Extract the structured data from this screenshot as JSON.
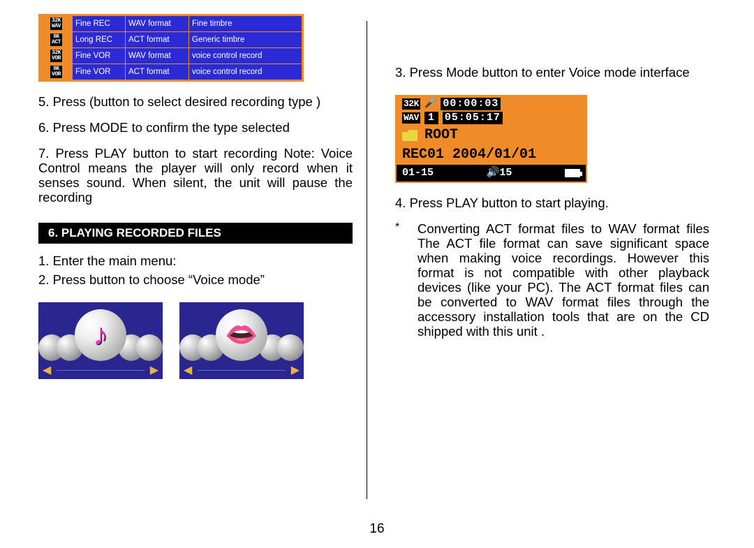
{
  "page_number": "16",
  "rec_table": {
    "rows": [
      {
        "badge_top": "32K",
        "badge_bot": "WAV",
        "mode": "Fine REC",
        "format": "WAV format",
        "desc": "Fine timbre"
      },
      {
        "badge_top": "8K",
        "badge_bot": "ACT",
        "mode": "Long REC",
        "format": "ACT format",
        "desc": "Generic timbre"
      },
      {
        "badge_top": "32K",
        "badge_bot": "VOR",
        "mode": "Fine VOR",
        "format": "WAV format",
        "desc": "voice control record"
      },
      {
        "badge_top": "8K",
        "badge_bot": "VOR",
        "mode": "Fine VOR",
        "format": "ACT format",
        "desc": "voice control record"
      }
    ]
  },
  "left": {
    "step5": "5. Press (button to select desired recording type )",
    "step6": "6. Press MODE to confirm the type selected",
    "step7": "7. Press PLAY button to start recording Note: Voice Control means the player will only record when it senses sound. When silent, the unit will pause the recording",
    "section_header": "6. PLAYING RECORDED FILES",
    "p1": "1. Enter the main menu:",
    "p2": "2. Press button to choose “Voice mode”"
  },
  "menu_icons": {
    "left_center": "♪",
    "right_center": "👄"
  },
  "right": {
    "step3": "3. Press Mode button to enter Voice mode interface",
    "step4": "4. Press PLAY button to start playing.",
    "note_marker": "*",
    "note": "Converting ACT format files to WAV format files   The ACT file format can save significant space when making voice recordings.  However this format is not compatible with other playback devices (like your PC).  The ACT format files can be converted to WAV format files through the accessory installation tools that are on the CD shipped with this unit ."
  },
  "voice_screen": {
    "badge1": "32K",
    "badge2": "WAV",
    "track_no": "1",
    "elapsed": "00:00:03",
    "total": "05:05:17",
    "folder": "ROOT",
    "filename": "REC01 2004/01/01",
    "range": "01-15",
    "volume": "15"
  }
}
